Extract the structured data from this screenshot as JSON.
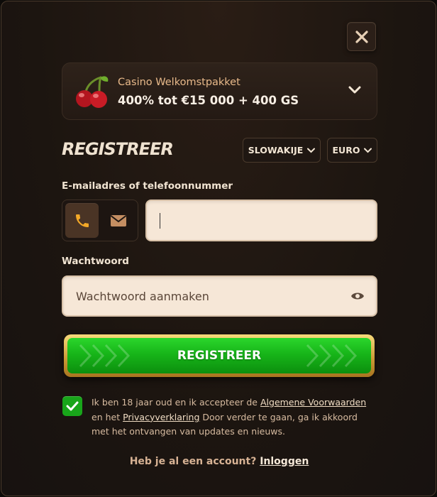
{
  "bonus": {
    "title": "Casino Welkomstpakket",
    "amount": "400% tot €15 000 + 400 GS"
  },
  "form": {
    "title": "REGISTREER",
    "country": "SLOWAKIJE",
    "currency": "EURO",
    "contact_label": "E-mailadres of telefoonnummer",
    "contact_value": "",
    "password_label": "Wachtwoord",
    "password_placeholder": "Wachtwoord aanmaken",
    "submit_label": "REGISTREER"
  },
  "terms": {
    "checked": true,
    "part1": "Ik ben 18 jaar oud en ik accepteer de ",
    "terms_link": "Algemene Voorwaarden",
    "part2": " en het ",
    "privacy_link": "Privacyverklaring",
    "part3": " Door verder te gaan, ga ik akkoord met het ontvangen van updates en nieuws."
  },
  "login": {
    "prompt": "Heb je al een account? ",
    "link": "Inloggen"
  },
  "colors": {
    "accent_green": "#18a51a",
    "gold_border": "#e8c060",
    "input_bg": "#f6e7d7",
    "background": "#1c1510"
  },
  "icons": [
    "close-icon",
    "cherry-icon",
    "chevron-down-icon",
    "phone-icon",
    "envelope-icon",
    "eye-icon",
    "checkmark-icon"
  ]
}
